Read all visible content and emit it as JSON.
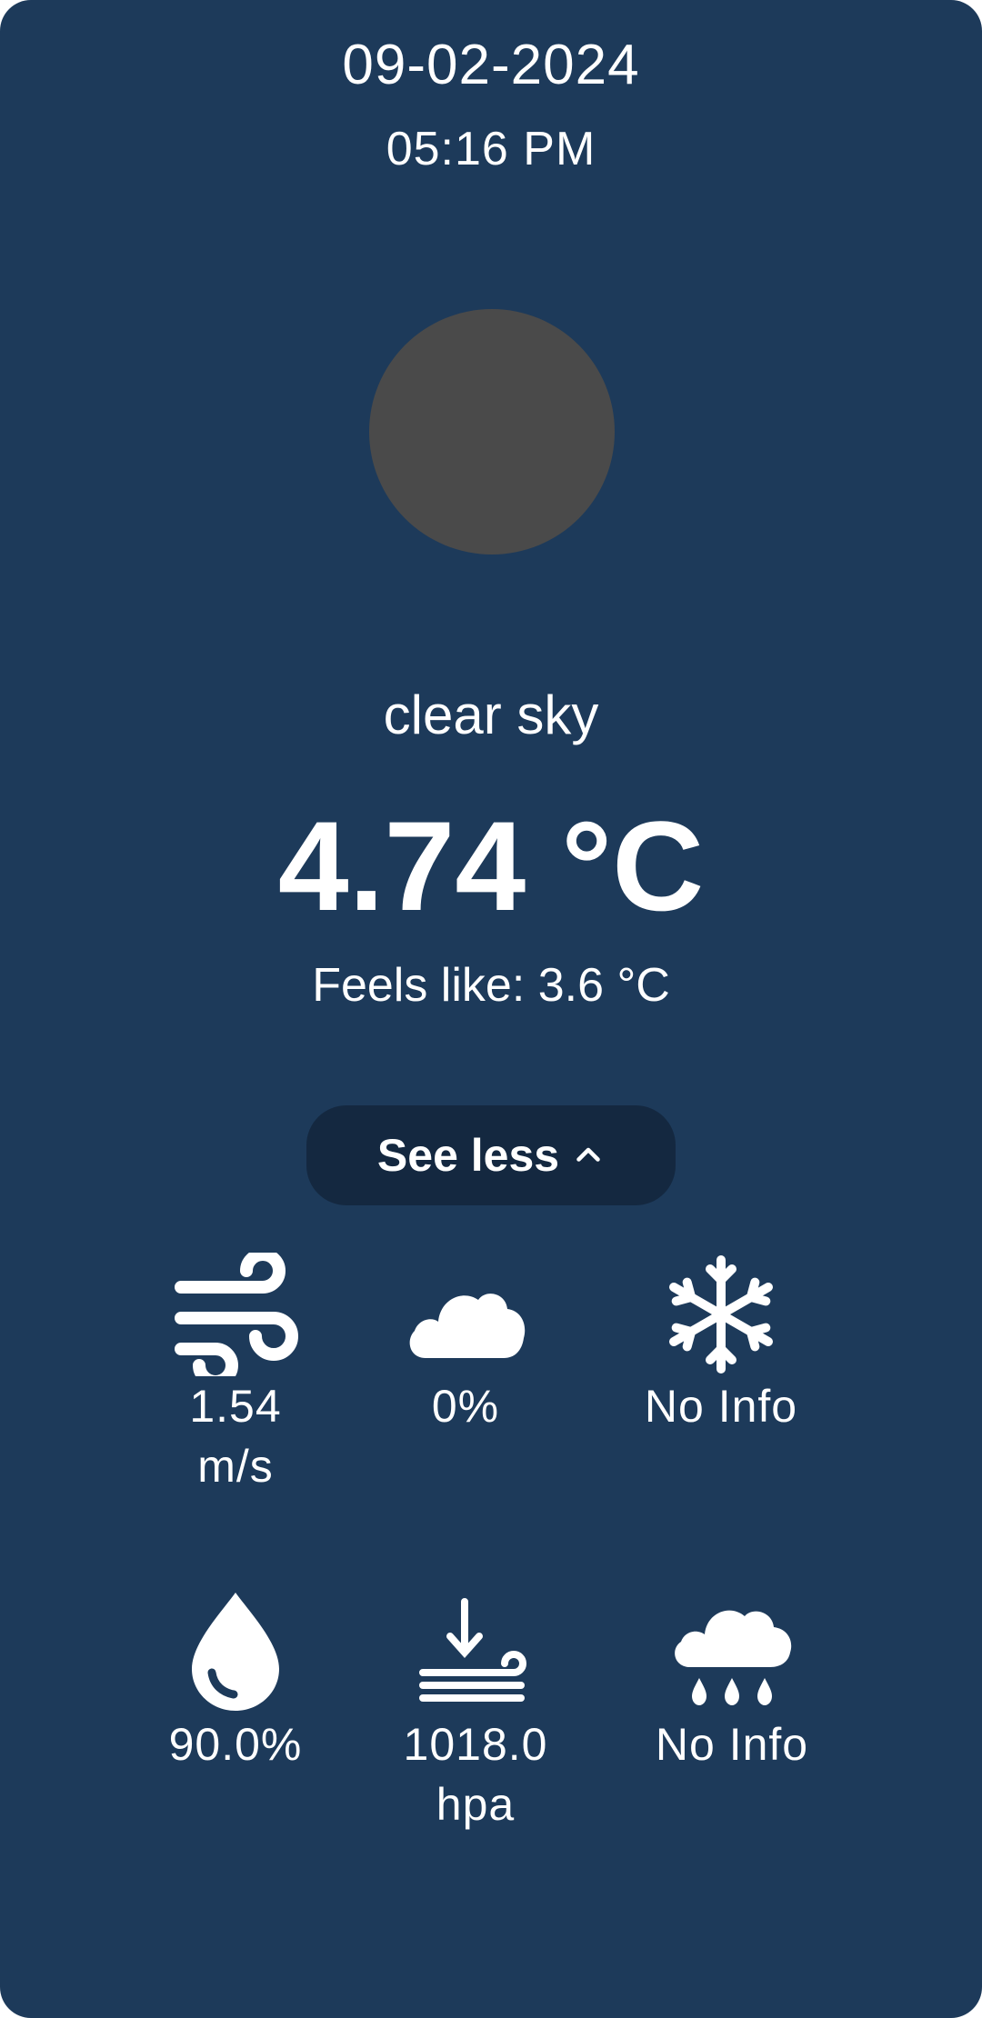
{
  "date": "09-02-2024",
  "time": "05:16 PM",
  "weather_icon": "weather-icon-placeholder",
  "description": "clear sky",
  "temperature": "4.74 °C",
  "feels_like": "Feels like: 3.6 °C",
  "toggle": {
    "label": "See less",
    "icon": "chevron-up-icon"
  },
  "stats": {
    "wind": {
      "icon": "wind-icon",
      "value_line1": "1.54",
      "value_line2": "m/s"
    },
    "clouds": {
      "icon": "cloud-icon",
      "value": "0%"
    },
    "snow": {
      "icon": "snowflake-icon",
      "value": "No Info"
    },
    "humidity": {
      "icon": "water-drop-icon",
      "value": "90.0%"
    },
    "pressure": {
      "icon": "air-pressure-icon",
      "value_line1": "1018.0",
      "value_line2": "hpa"
    },
    "rain": {
      "icon": "rain-cloud-icon",
      "value": "No Info"
    }
  },
  "colors": {
    "background": "#1d3a5a",
    "button": "#142840",
    "text": "#ffffff",
    "icon_placeholder": "#4a4a4a"
  }
}
